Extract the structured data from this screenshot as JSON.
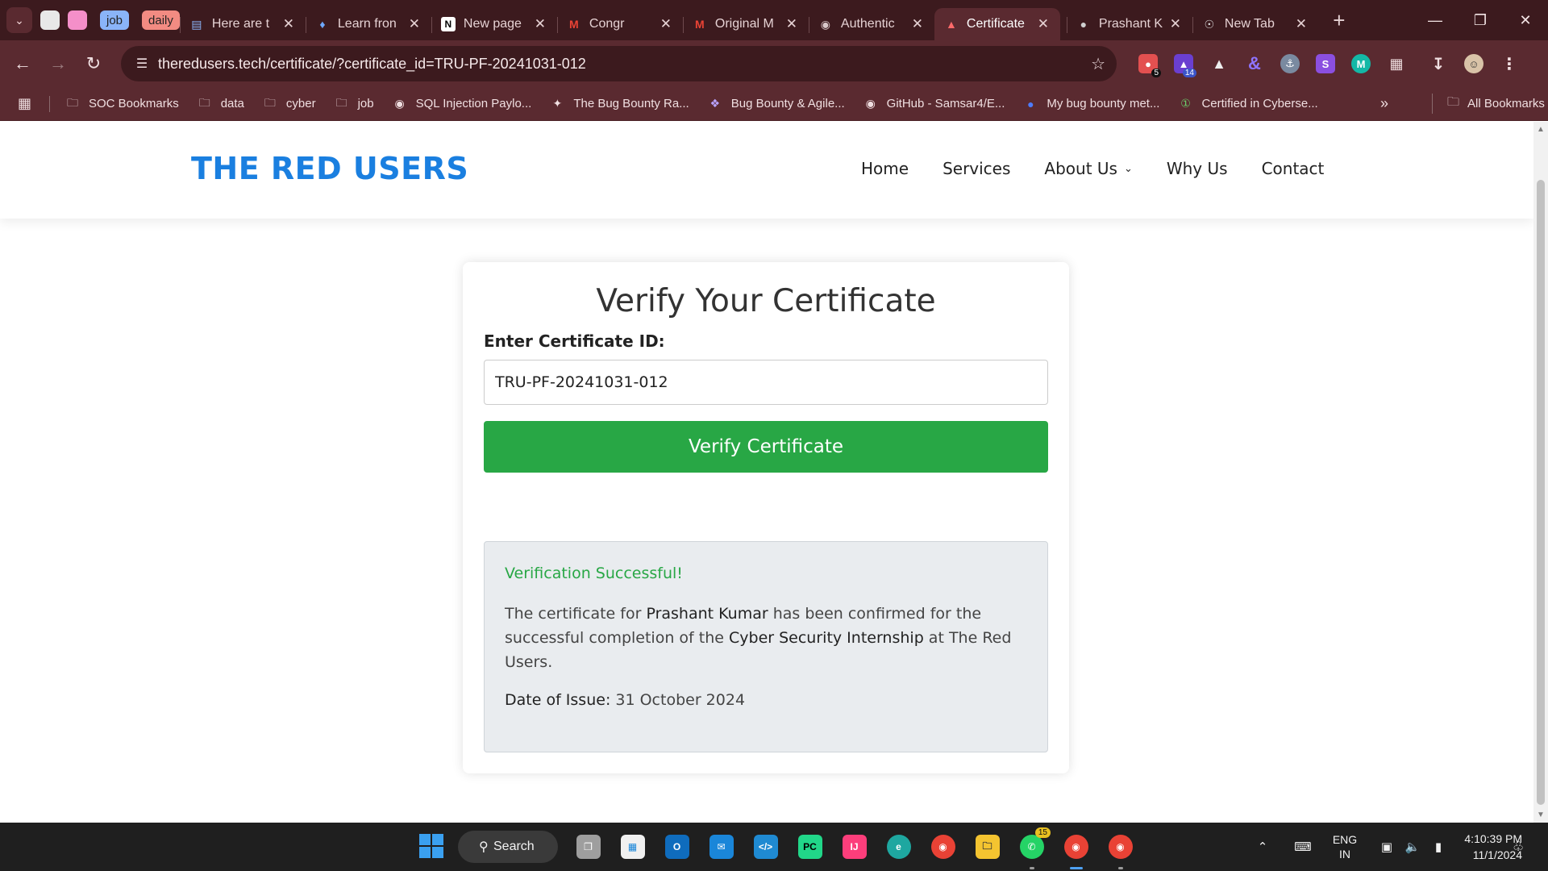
{
  "browser": {
    "pinned_tabs": [
      {
        "label": ""
      },
      {
        "label": ""
      },
      {
        "label": "job"
      },
      {
        "label": "daily"
      }
    ],
    "tabs": [
      {
        "title": "Here are t",
        "icon": "doc-icon",
        "active": false
      },
      {
        "title": "Learn fron",
        "icon": "hackerone-icon",
        "active": false
      },
      {
        "title": "New page",
        "icon": "notion-icon",
        "active": false
      },
      {
        "title": "Congr",
        "icon": "gmail-icon",
        "active": false
      },
      {
        "title": "Original M",
        "icon": "gmail-icon",
        "active": false
      },
      {
        "title": "Authentic",
        "icon": "fingerprint-icon",
        "active": false
      },
      {
        "title": "Certificate",
        "icon": "certificate-icon",
        "active": true
      },
      {
        "title": "Prashant K",
        "icon": "globe-icon",
        "active": false
      },
      {
        "title": "New Tab",
        "icon": "chrome-icon",
        "active": false
      }
    ],
    "url": "theredusers.tech/certificate/?certificate_id=TRU-PF-20241031-012",
    "extensions": [
      {
        "icon": "extension-red-icon",
        "badge": "5",
        "color": "#e35050"
      },
      {
        "icon": "extension-purple-icon",
        "badge": "14",
        "color": "#6a3fd0"
      },
      {
        "icon": "extension-triangle-icon",
        "badge": "",
        "color": "#dddddd"
      },
      {
        "icon": "extension-ampersand-icon",
        "badge": "",
        "color": "#7b5cff"
      },
      {
        "icon": "extension-ship-icon",
        "badge": "",
        "color": "#7a8aa0"
      },
      {
        "icon": "extension-s-icon",
        "badge": "",
        "color": "#8b4fe0"
      },
      {
        "icon": "extension-m-icon",
        "badge": "",
        "color": "#14b8a6"
      },
      {
        "icon": "puzzle-icon",
        "badge": "",
        "color": "#5a2a30"
      }
    ],
    "bookmarks": [
      {
        "label": "SOC Bookmarks",
        "icon": "folder-icon"
      },
      {
        "label": "data",
        "icon": "folder-icon"
      },
      {
        "label": "cyber",
        "icon": "folder-icon"
      },
      {
        "label": "job",
        "icon": "folder-icon"
      },
      {
        "label": "SQL Injection Paylo...",
        "icon": "github-icon"
      },
      {
        "label": "The Bug Bounty Ra...",
        "icon": "bird-icon"
      },
      {
        "label": "Bug Bounty & Agile...",
        "icon": "bug-icon"
      },
      {
        "label": "GitHub - Samsar4/E...",
        "icon": "github-icon"
      },
      {
        "label": "My bug bounty met...",
        "icon": "globe-icon"
      },
      {
        "label": "Certified in Cyberse...",
        "icon": "badge-icon"
      }
    ],
    "all_bookmarks_label": "All Bookmarks"
  },
  "site": {
    "logo": "THE RED USERS",
    "nav": [
      "Home",
      "Services",
      "About Us",
      "Why Us",
      "Contact"
    ]
  },
  "form": {
    "title": "Verify Your Certificate",
    "label": "Enter Certificate ID:",
    "value": "TRU-PF-20241031-012",
    "button": "Verify Certificate"
  },
  "result": {
    "status": "Verification Successful!",
    "msg_prefix": "The certificate for ",
    "name": "Prashant Kumar",
    "msg_middle": " has been confirmed for the successful completion of the ",
    "program": "Cyber Security Internship",
    "msg_suffix": " at The Red Users.",
    "date_label": "Date of Issue:",
    "date_value": "31 October 2024"
  },
  "taskbar": {
    "search_label": "Search",
    "apps": [
      {
        "icon": "task-view-icon",
        "color": "#9e9e9e",
        "badge": ""
      },
      {
        "icon": "store-icon",
        "color": "#f0f0f0",
        "badge": ""
      },
      {
        "icon": "outlook-icon",
        "color": "#0f6cbd",
        "badge": ""
      },
      {
        "icon": "mail-icon",
        "color": "#1a86d9",
        "badge": ""
      },
      {
        "icon": "vscode-icon",
        "color": "#1f8ad2",
        "badge": ""
      },
      {
        "icon": "pycharm-icon",
        "color": "#21d789",
        "badge": ""
      },
      {
        "icon": "intellij-icon",
        "color": "#fc3e7b",
        "badge": ""
      },
      {
        "icon": "edge-icon",
        "color": "#1ea7a0",
        "badge": ""
      },
      {
        "icon": "chrome-icon",
        "color": "#e94235",
        "badge": ""
      },
      {
        "icon": "file-explorer-icon",
        "color": "#f4c430",
        "badge": ""
      },
      {
        "icon": "whatsapp-icon",
        "color": "#25d366",
        "badge": "15"
      },
      {
        "icon": "chrome-profile-icon",
        "color": "#e94235",
        "badge": ""
      },
      {
        "icon": "chrome-profile-r-icon",
        "color": "#e94235",
        "badge": ""
      }
    ],
    "lang_line1": "ENG",
    "lang_line2": "IN",
    "time": "4:10:39 PM",
    "date": "11/1/2024"
  }
}
